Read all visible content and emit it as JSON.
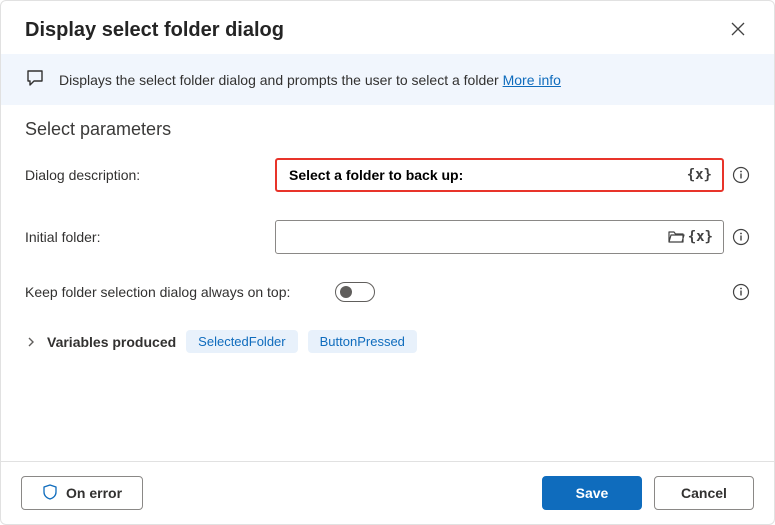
{
  "dialog": {
    "title": "Display select folder dialog",
    "description": "Displays the select folder dialog and prompts the user to select a folder",
    "more_info": "More info"
  },
  "section": {
    "title": "Select parameters"
  },
  "fields": {
    "dialog_description": {
      "label": "Dialog description:",
      "value": "Select a folder to back up:",
      "var_icon": "{x}"
    },
    "initial_folder": {
      "label": "Initial folder:",
      "value": "",
      "var_icon": "{x}"
    },
    "keep_on_top": {
      "label": "Keep folder selection dialog always on top:",
      "value": false
    }
  },
  "variables": {
    "label": "Variables produced",
    "items": [
      "SelectedFolder",
      "ButtonPressed"
    ]
  },
  "footer": {
    "on_error": "On error",
    "save": "Save",
    "cancel": "Cancel"
  }
}
